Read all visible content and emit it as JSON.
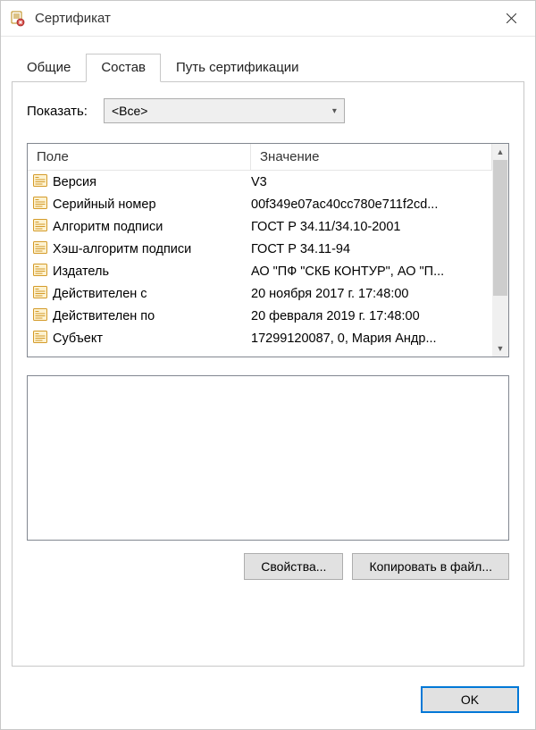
{
  "window": {
    "title": "Сертификат"
  },
  "tabs": {
    "general": "Общие",
    "details": "Состав",
    "path": "Путь сертификации"
  },
  "filter": {
    "label": "Показать:",
    "value": "<Все>"
  },
  "columns": {
    "field": "Поле",
    "value": "Значение"
  },
  "rows": [
    {
      "field": "Версия",
      "value": "V3"
    },
    {
      "field": "Серийный номер",
      "value": "00f349e07ac40cc780e711f2cd..."
    },
    {
      "field": "Алгоритм подписи",
      "value": "ГОСТ Р 34.11/34.10-2001"
    },
    {
      "field": "Хэш-алгоритм подписи",
      "value": "ГОСТ Р 34.11-94"
    },
    {
      "field": "Издатель",
      "value": "АО \"ПФ \"СКБ КОНТУР\", АО \"П..."
    },
    {
      "field": "Действителен с",
      "value": "20 ноября 2017 г. 17:48:00"
    },
    {
      "field": "Действителен по",
      "value": "20 февраля 2019 г. 17:48:00"
    },
    {
      "field": "Субъект",
      "value": "17299120087, 0, Мария Андр..."
    }
  ],
  "buttons": {
    "properties": "Свойства...",
    "copy": "Копировать в файл...",
    "ok": "OK"
  }
}
